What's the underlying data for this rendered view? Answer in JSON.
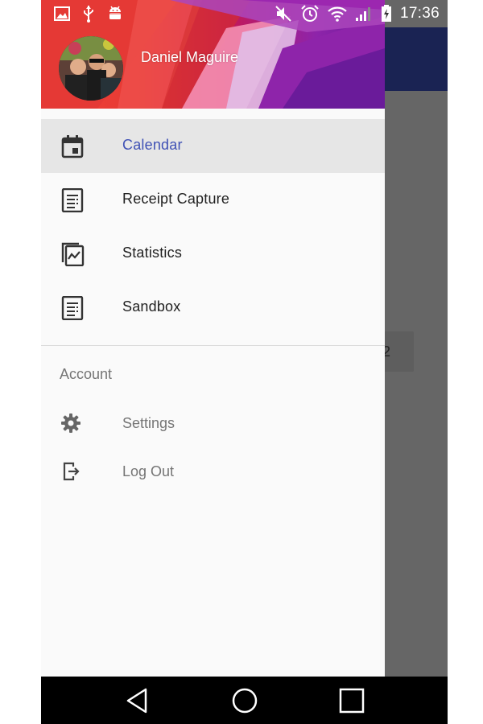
{
  "status_bar": {
    "time": "17:36",
    "left_icons": [
      "image-icon",
      "usb-icon",
      "android-icon"
    ],
    "right_icons": [
      "mute-icon",
      "alarm-icon",
      "wifi-icon",
      "signal-icon",
      "battery-icon"
    ]
  },
  "drawer": {
    "user_name": "Daniel Maguire",
    "menu_items": [
      {
        "label": "Calendar",
        "icon": "calendar-icon",
        "active": true
      },
      {
        "label": "Receipt Capture",
        "icon": "receipt-icon",
        "active": false
      },
      {
        "label": "Statistics",
        "icon": "statistics-icon",
        "active": false
      },
      {
        "label": "Sandbox",
        "icon": "sandbox-icon",
        "active": false
      }
    ],
    "section_title": "Account",
    "account_items": [
      {
        "label": "Settings",
        "icon": "gear-icon"
      },
      {
        "label": "Log Out",
        "icon": "logout-icon"
      }
    ]
  },
  "background_app": {
    "partial_button_text": "2"
  },
  "nav_bar": {
    "buttons": [
      "back-icon",
      "home-icon",
      "recents-icon"
    ]
  },
  "colors": {
    "accent": "#3f51b5",
    "app_bar": "#1a2353",
    "scrim": "#666666",
    "active_item_bg": "#e6e6e6"
  }
}
